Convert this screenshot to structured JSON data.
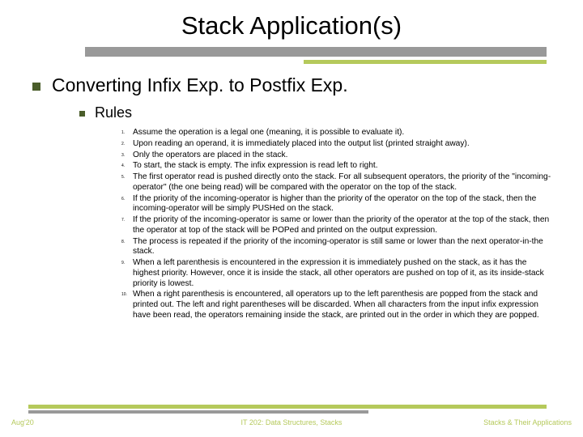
{
  "title": "Stack Application(s)",
  "level1": "Converting Infix Exp. to Postfix Exp.",
  "level2": "Rules",
  "rules": [
    "Assume the operation is a legal one (meaning, it is possible to evaluate it).",
    "Upon reading an operand, it is immediately placed into the output list (printed straight away).",
    "Only the operators are placed in the stack.",
    "To start, the stack is empty. The infix expression is read left to right.",
    "The first operator read is pushed directly onto the stack. For all subsequent operators, the priority of the \"incoming-operator\" (the one being read) will be compared with the operator on the top of the stack.",
    "If the priority of the incoming-operator is higher than the priority of the operator on the top of the stack, then the incoming-operator will be simply PUSHed on the stack.",
    "If the priority of the incoming-operator is same or lower than the priority of the operator at the top of the stack, then the operator at top of the stack will be POPed and printed on the output expression.",
    "The process is repeated if the priority of the incoming-operator is still same or lower than the next operator-in-the stack.",
    "When a left parenthesis is encountered in the expression it is immediately pushed on the stack, as it has the highest priority. However, once it is inside the stack, all other operators are pushed on top of it, as its inside-stack priority is lowest.",
    "When a right parenthesis is encountered, all operators up to the left parenthesis are popped from the stack and printed out. The left and right parentheses will be discarded. When all characters from the input infix expression have been read, the operators remaining inside the stack, are printed out in the order in which they are popped."
  ],
  "footer": {
    "left": "Aug'20",
    "center": "IT 202: Data Structures, Stacks",
    "right": "Stacks & Their Applications"
  }
}
